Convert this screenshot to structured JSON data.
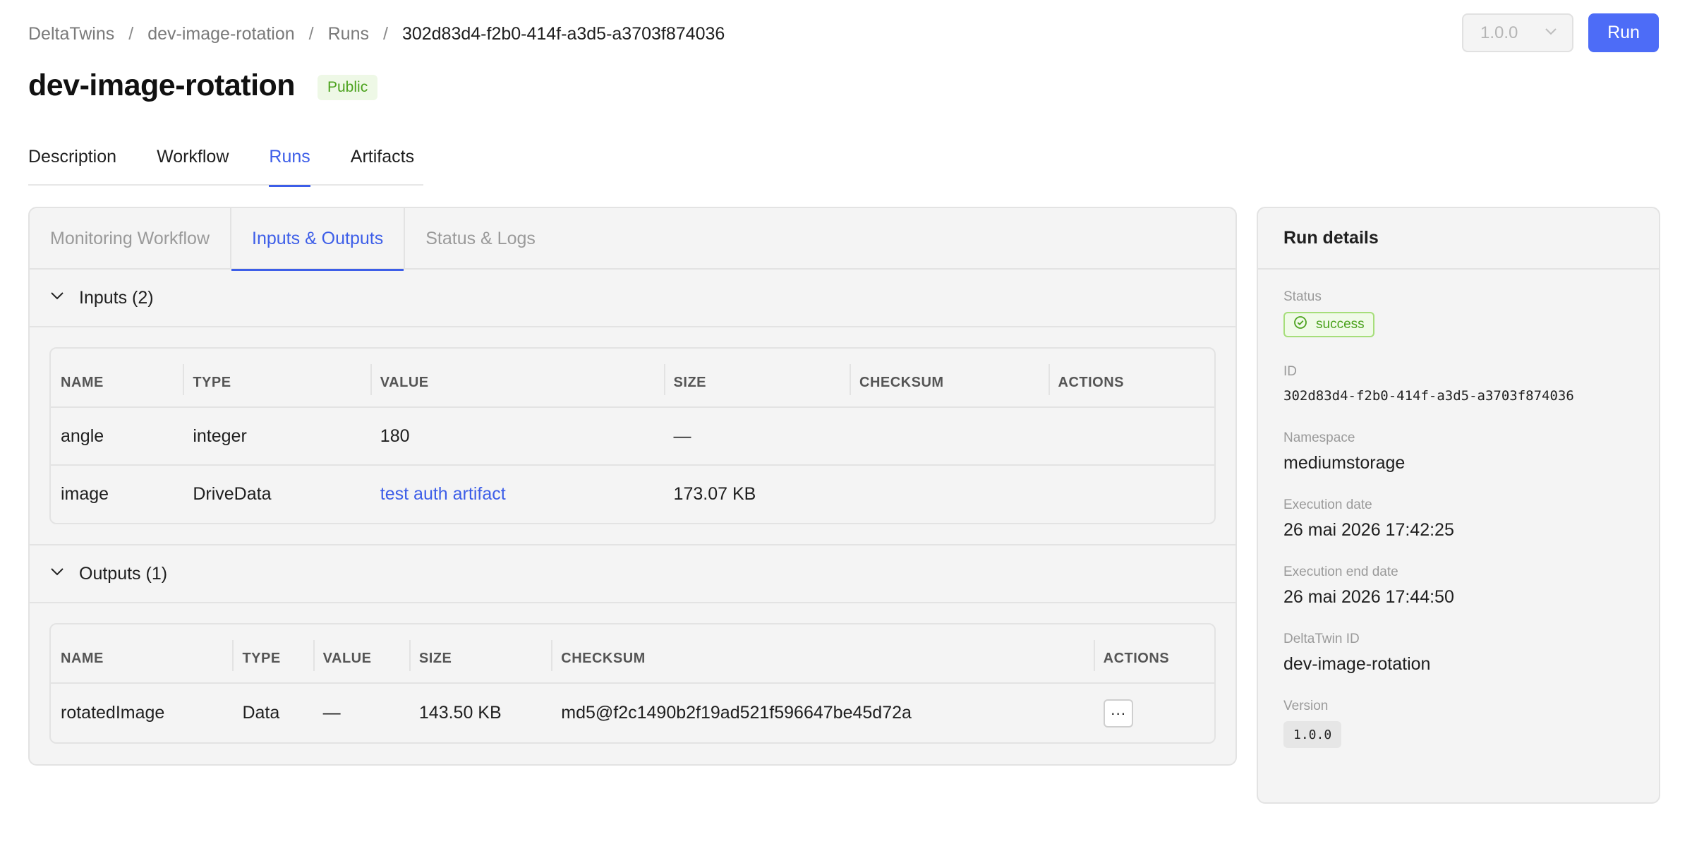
{
  "breadcrumb": {
    "items": [
      "DeltaTwins",
      "dev-image-rotation",
      "Runs"
    ],
    "current": "302d83d4-f2b0-414f-a3d5-a3703f874036",
    "separator": "/"
  },
  "header": {
    "version_value": "1.0.0",
    "run_label": "Run",
    "title": "dev-image-rotation",
    "badge": "Public"
  },
  "main_tabs": [
    "Description",
    "Workflow",
    "Runs",
    "Artifacts"
  ],
  "main_tab_active": "Runs",
  "sub_tabs": [
    "Monitoring Workflow",
    "Inputs & Outputs",
    "Status & Logs"
  ],
  "sub_tab_active": "Inputs & Outputs",
  "inputs": {
    "title": "Inputs (2)",
    "columns": [
      "NAME",
      "TYPE",
      "VALUE",
      "SIZE",
      "CHECKSUM",
      "ACTIONS"
    ],
    "rows": [
      {
        "name": "angle",
        "type": "integer",
        "value": "180",
        "size": "—",
        "checksum": ""
      },
      {
        "name": "image",
        "type": "DriveData",
        "value": "test auth artifact",
        "size": "173.07 KB",
        "checksum": ""
      }
    ]
  },
  "outputs": {
    "title": "Outputs (1)",
    "columns": [
      "NAME",
      "TYPE",
      "VALUE",
      "SIZE",
      "CHECKSUM",
      "ACTIONS"
    ],
    "rows": [
      {
        "name": "rotatedImage",
        "type": "Data",
        "value": "—",
        "size": "143.50 KB",
        "checksum": "md5@f2c1490b2f19ad521f596647be45d72a",
        "action": "···"
      }
    ]
  },
  "run_details": {
    "title": "Run details",
    "status_label": "Status",
    "status_value": "success",
    "id_label": "ID",
    "id_value": "302d83d4-f2b0-414f-a3d5-a3703f874036",
    "namespace_label": "Namespace",
    "namespace_value": "mediumstorage",
    "exec_date_label": "Execution date",
    "exec_date_value": "26 mai 2026 17:42:25",
    "exec_end_label": "Execution end date",
    "exec_end_value": "26 mai 2026 17:44:50",
    "deltatwin_id_label": "DeltaTwin ID",
    "deltatwin_id_value": "dev-image-rotation",
    "version_label": "Version",
    "version_value": "1.0.0"
  },
  "colors": {
    "accent": "#4d6cf7",
    "link": "#3d5ee8",
    "success": "#4ba21d",
    "card_bg": "#f4f4f4",
    "border": "#e3e3e3"
  },
  "icons": {
    "chevron": "chevron-down-icon",
    "status": "check-circle-icon"
  }
}
